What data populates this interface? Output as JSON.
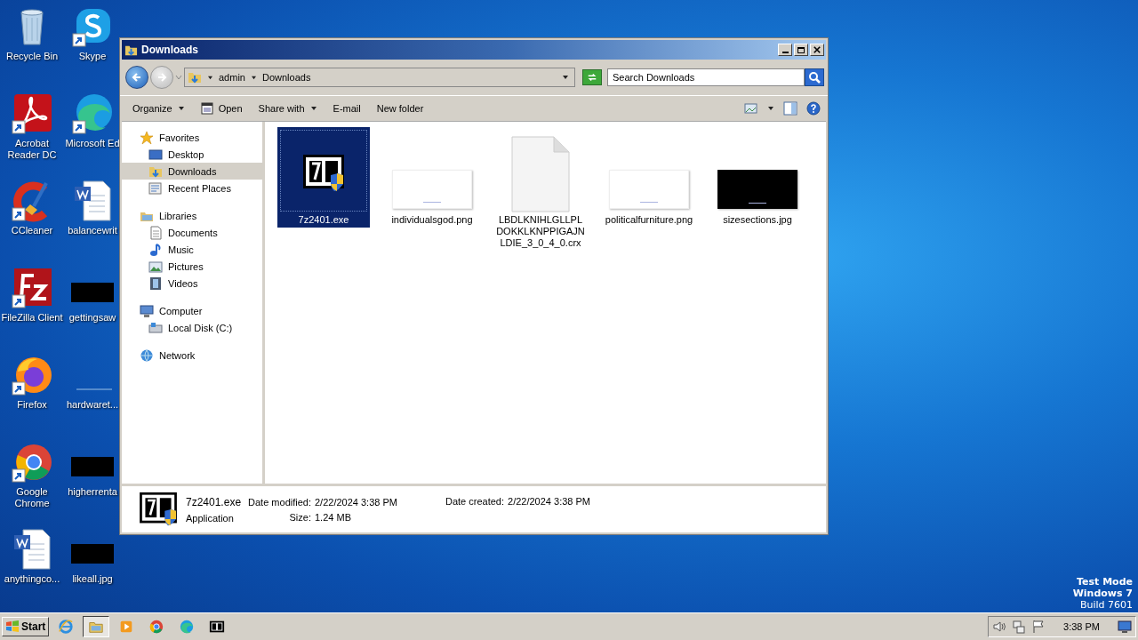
{
  "desktop": {
    "icons": [
      {
        "label": "Recycle Bin",
        "kind": "recycle",
        "shortcut": false
      },
      {
        "label": "Skype",
        "kind": "skype",
        "shortcut": true
      },
      {
        "label": "Acrobat Reader DC",
        "kind": "acrobat",
        "shortcut": true
      },
      {
        "label": "Microsoft Ed",
        "kind": "edge",
        "shortcut": true
      },
      {
        "label": "CCleaner",
        "kind": "ccleaner",
        "shortcut": true
      },
      {
        "label": "balancewrit",
        "kind": "word",
        "shortcut": false
      },
      {
        "label": "FileZilla Client",
        "kind": "filezilla",
        "shortcut": true
      },
      {
        "label": "gettingsaw",
        "kind": "redacted",
        "shortcut": false
      },
      {
        "label": "Firefox",
        "kind": "firefox",
        "shortcut": true
      },
      {
        "label": "hardwaret...",
        "kind": "blank",
        "shortcut": false
      },
      {
        "label": "Google Chrome",
        "kind": "chrome",
        "shortcut": true
      },
      {
        "label": "higherrenta",
        "kind": "redacted",
        "shortcut": false
      },
      {
        "label": "anythingco...",
        "kind": "word",
        "shortcut": false
      },
      {
        "label": "likeall.jpg",
        "kind": "redacted",
        "shortcut": false
      }
    ],
    "system_notice": [
      "Test Mode",
      "Windows 7",
      "Build 7601"
    ]
  },
  "window": {
    "title": "Downloads",
    "breadcrumb": [
      "admin",
      "Downloads"
    ],
    "search": {
      "placeholder": "Search Downloads"
    },
    "toolbar": [
      {
        "label": "Organize",
        "kind": "menu"
      },
      {
        "label": "Open",
        "kind": "open"
      },
      {
        "label": "Share with",
        "kind": "menu"
      },
      {
        "label": "E-mail",
        "kind": "plain"
      },
      {
        "label": "New folder",
        "kind": "plain"
      }
    ],
    "nav": [
      {
        "label": "Favorites",
        "kind": "star",
        "selected": false,
        "children": [
          {
            "label": "Desktop",
            "kind": "desktop",
            "selected": false
          },
          {
            "label": "Downloads",
            "kind": "download",
            "selected": true
          },
          {
            "label": "Recent Places",
            "kind": "recent",
            "selected": false
          }
        ]
      },
      {
        "label": "Libraries",
        "kind": "library",
        "selected": false,
        "children": [
          {
            "label": "Documents",
            "kind": "document",
            "selected": false
          },
          {
            "label": "Music",
            "kind": "music",
            "selected": false
          },
          {
            "label": "Pictures",
            "kind": "pictures",
            "selected": false
          },
          {
            "label": "Videos",
            "kind": "videos",
            "selected": false
          }
        ]
      },
      {
        "label": "Computer",
        "kind": "computer",
        "selected": false,
        "children": [
          {
            "label": "Local Disk (C:)",
            "kind": "disk",
            "selected": false
          }
        ]
      },
      {
        "label": "Network",
        "kind": "network",
        "selected": false
      }
    ],
    "files": [
      {
        "name": "7z2401.exe",
        "kind": "exe",
        "selected": true
      },
      {
        "name": "individualsgod.png",
        "kind": "white-image",
        "selected": false
      },
      {
        "name": "LBDLKNIHLGLLPLDOKKLKNPPIGAJNLDIE_3_0_4_0.crx",
        "kind": "blank-file",
        "selected": false
      },
      {
        "name": "politicalfurniture.png",
        "kind": "white-image",
        "selected": false
      },
      {
        "name": "sizesections.jpg",
        "kind": "black-image",
        "selected": false
      }
    ],
    "details": {
      "name": "7z2401.exe",
      "type": "Application",
      "modified_label": "Date modified:",
      "modified": "2/22/2024 3:38 PM",
      "created_label": "Date created:",
      "created": "2/22/2024 3:38 PM",
      "size_label": "Size:",
      "size": "1.24 MB"
    }
  },
  "taskbar": {
    "start": "Start",
    "apps": [
      {
        "kind": "ie",
        "active": false
      },
      {
        "kind": "explorer",
        "active": true
      },
      {
        "kind": "media",
        "active": false
      },
      {
        "kind": "chrome",
        "active": false
      },
      {
        "kind": "edge",
        "active": false
      },
      {
        "kind": "sevenzip",
        "active": false
      }
    ],
    "clock": "3:38 PM"
  }
}
